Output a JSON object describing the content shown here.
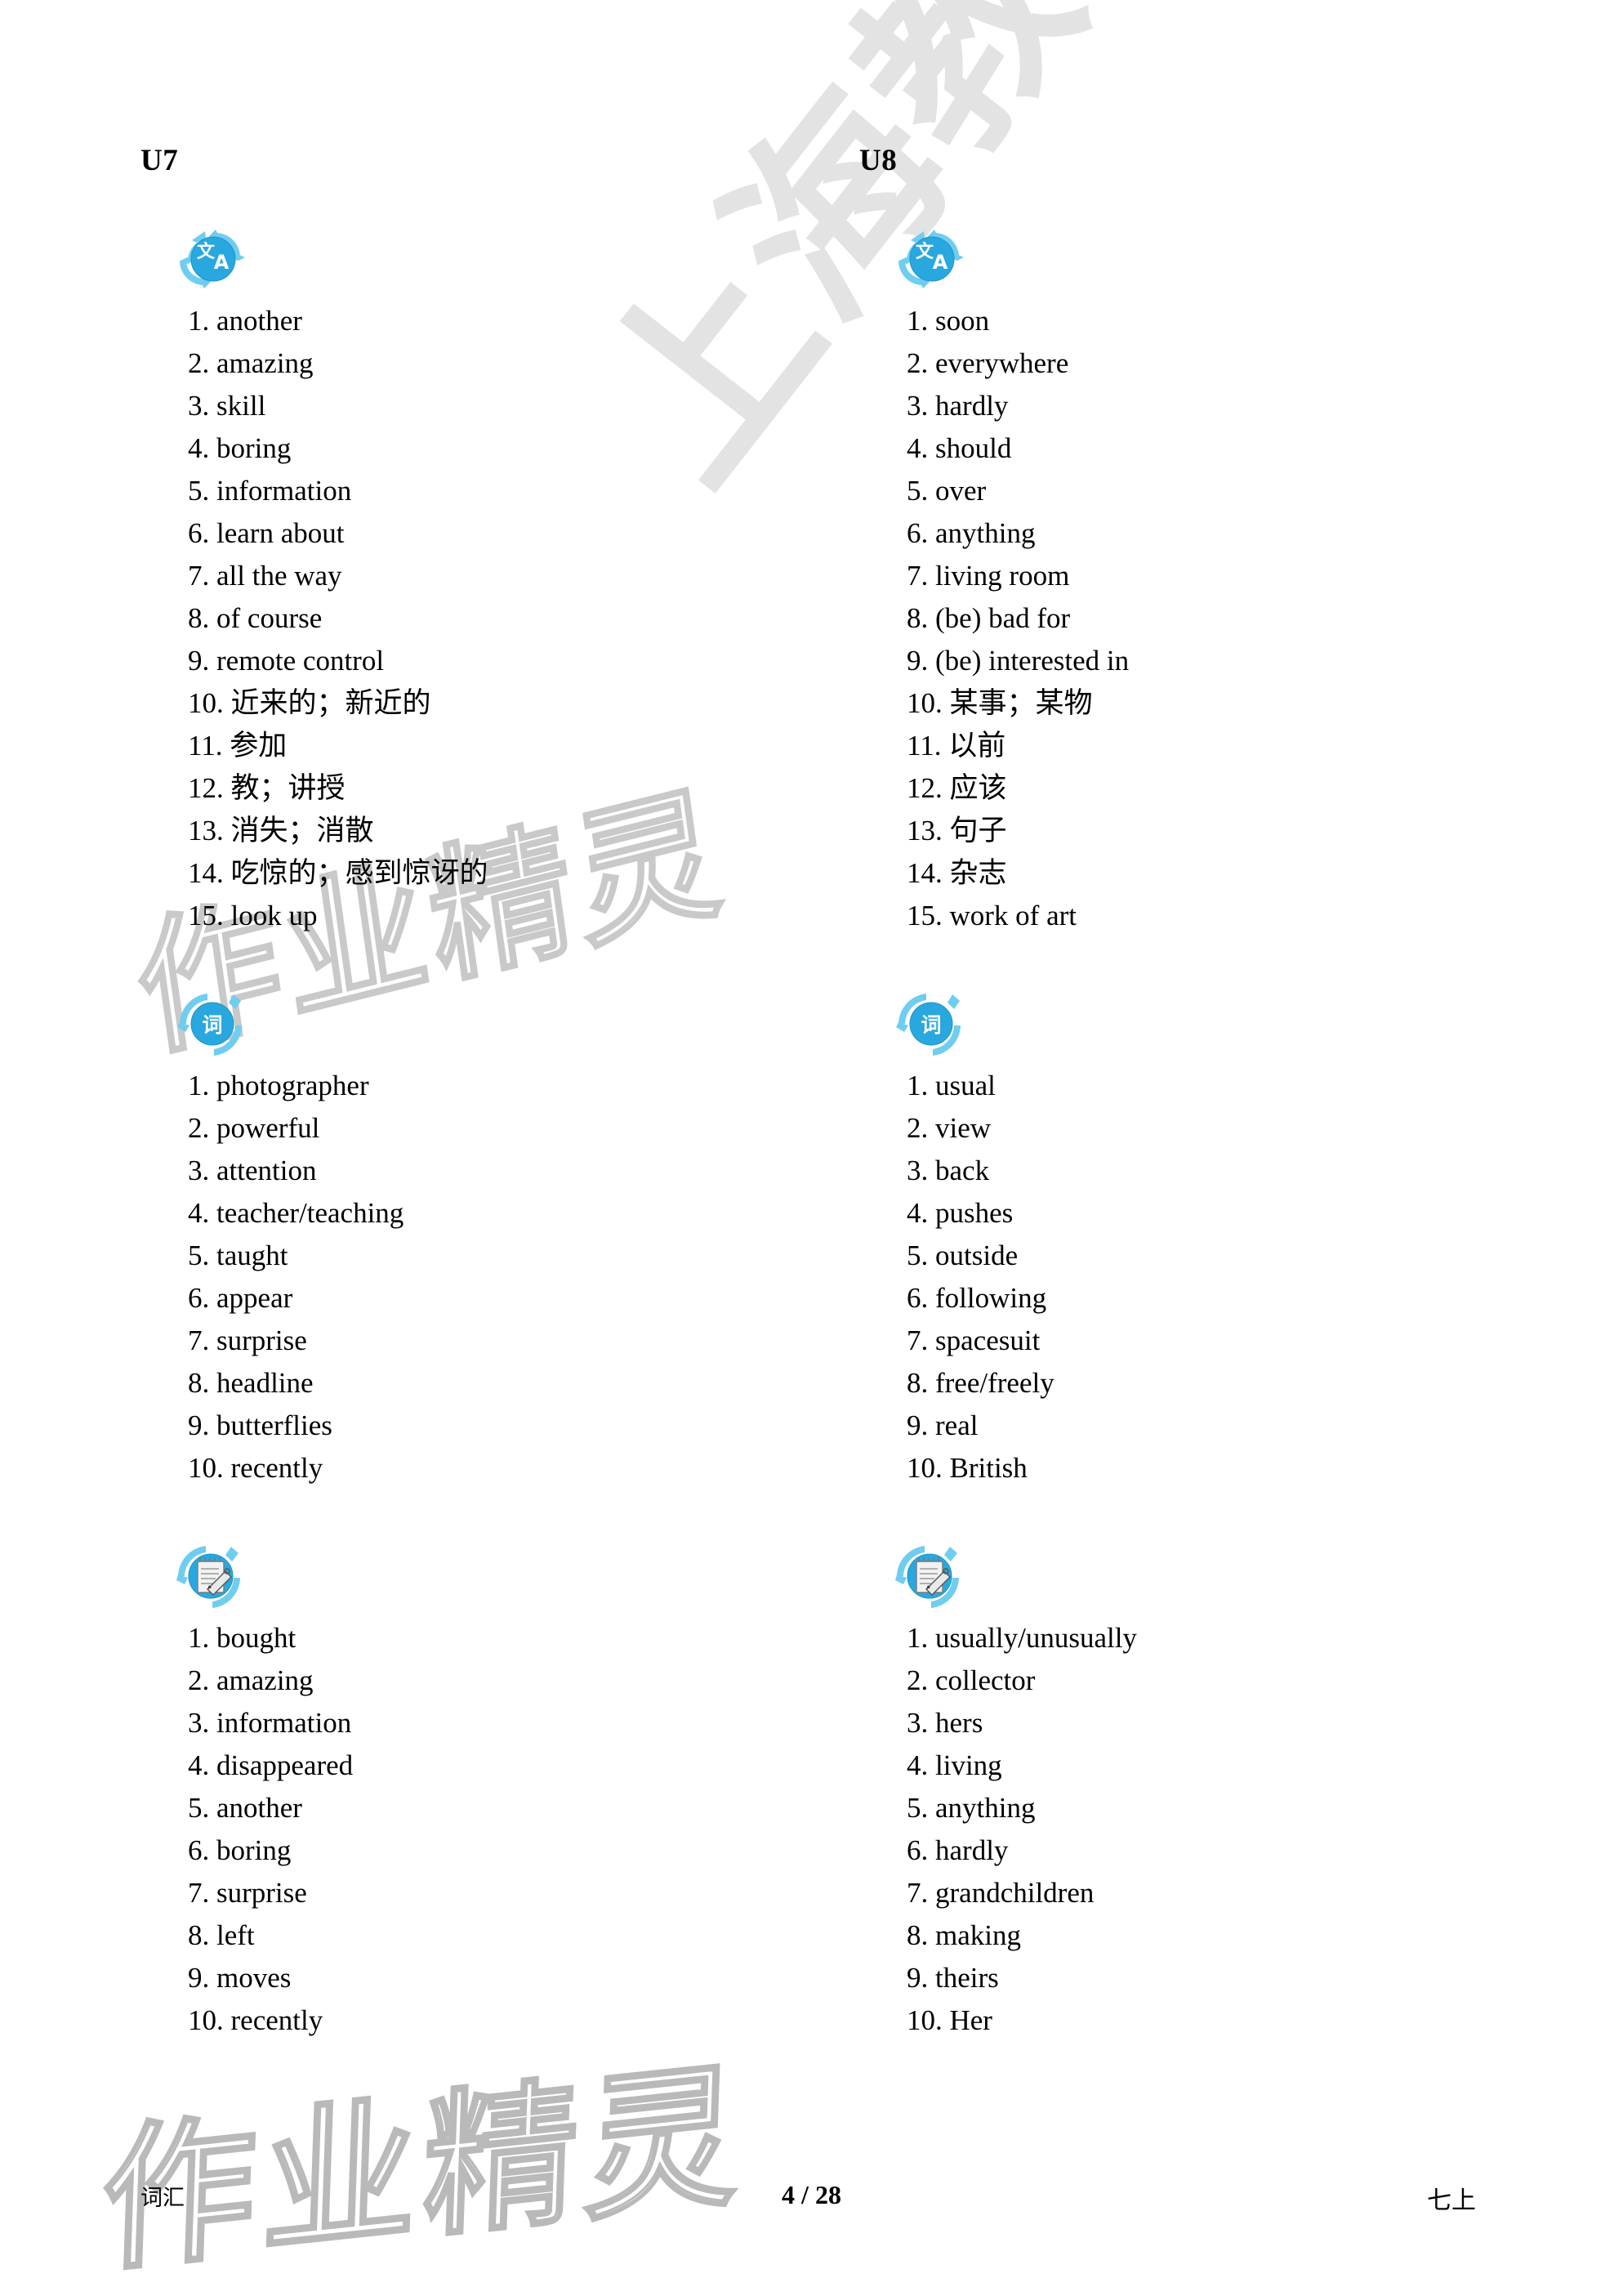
{
  "page": {
    "background_color": "#ffffff",
    "text_color": "#000000",
    "accent_color": "#2eaae0"
  },
  "watermarks": {
    "publisher": "上海教育出版社",
    "brand_body": "作业精灵",
    "brand_footer": "作业精灵"
  },
  "columns": [
    {
      "title": "U7",
      "sections": [
        {
          "icon": "translate-icon",
          "icon_label": "文A",
          "items": [
            "1. another",
            "2. amazing",
            "3. skill",
            "4. boring",
            "5. information",
            "6. learn about",
            "7. all the way",
            "8. of course",
            "9. remote control",
            "10. 近来的；新近的",
            "11. 参加",
            "12. 教；讲授",
            "13. 消失；消散",
            "14. 吃惊的；感到惊讶的",
            "15. look up"
          ]
        },
        {
          "icon": "word-icon",
          "icon_label": "词",
          "items": [
            "1. photographer",
            "2. powerful",
            "3. attention",
            "4. teacher/teaching",
            "5. taught",
            "6. appear",
            "7. surprise",
            "8. headline",
            "9. butterflies",
            "10. recently"
          ]
        },
        {
          "icon": "notepad-pencil-icon",
          "icon_label": "",
          "items": [
            "1. bought",
            "2. amazing",
            "3. information",
            "4. disappeared",
            "5. another",
            "6. boring",
            "7. surprise",
            "8. left",
            "9. moves",
            "10. recently"
          ]
        }
      ]
    },
    {
      "title": "U8",
      "sections": [
        {
          "icon": "translate-icon",
          "icon_label": "文A",
          "items": [
            "1. soon",
            "2. everywhere",
            "3. hardly",
            "4. should",
            "5. over",
            "6. anything",
            "7. living room",
            "8. (be) bad for",
            "9. (be) interested in",
            "10. 某事；某物",
            "11. 以前",
            "12. 应该",
            "13. 句子",
            "14. 杂志",
            "15. work of art"
          ]
        },
        {
          "icon": "word-icon",
          "icon_label": "词",
          "items": [
            "1. usual",
            "2. view",
            "3. back",
            "4. pushes",
            "5. outside",
            "6. following",
            "7. spacesuit",
            "8. free/freely",
            "9. real",
            "10. British"
          ]
        },
        {
          "icon": "notepad-pencil-icon",
          "icon_label": "",
          "items": [
            "1. usually/unusually",
            "2. collector",
            "3. hers",
            "4. living",
            "5. anything",
            "6. hardly",
            "7. grandchildren",
            "8. making",
            "9. theirs",
            "10. Her"
          ]
        }
      ]
    }
  ],
  "footer": {
    "left": "词汇",
    "center": "4 / 28",
    "right": "七上"
  }
}
